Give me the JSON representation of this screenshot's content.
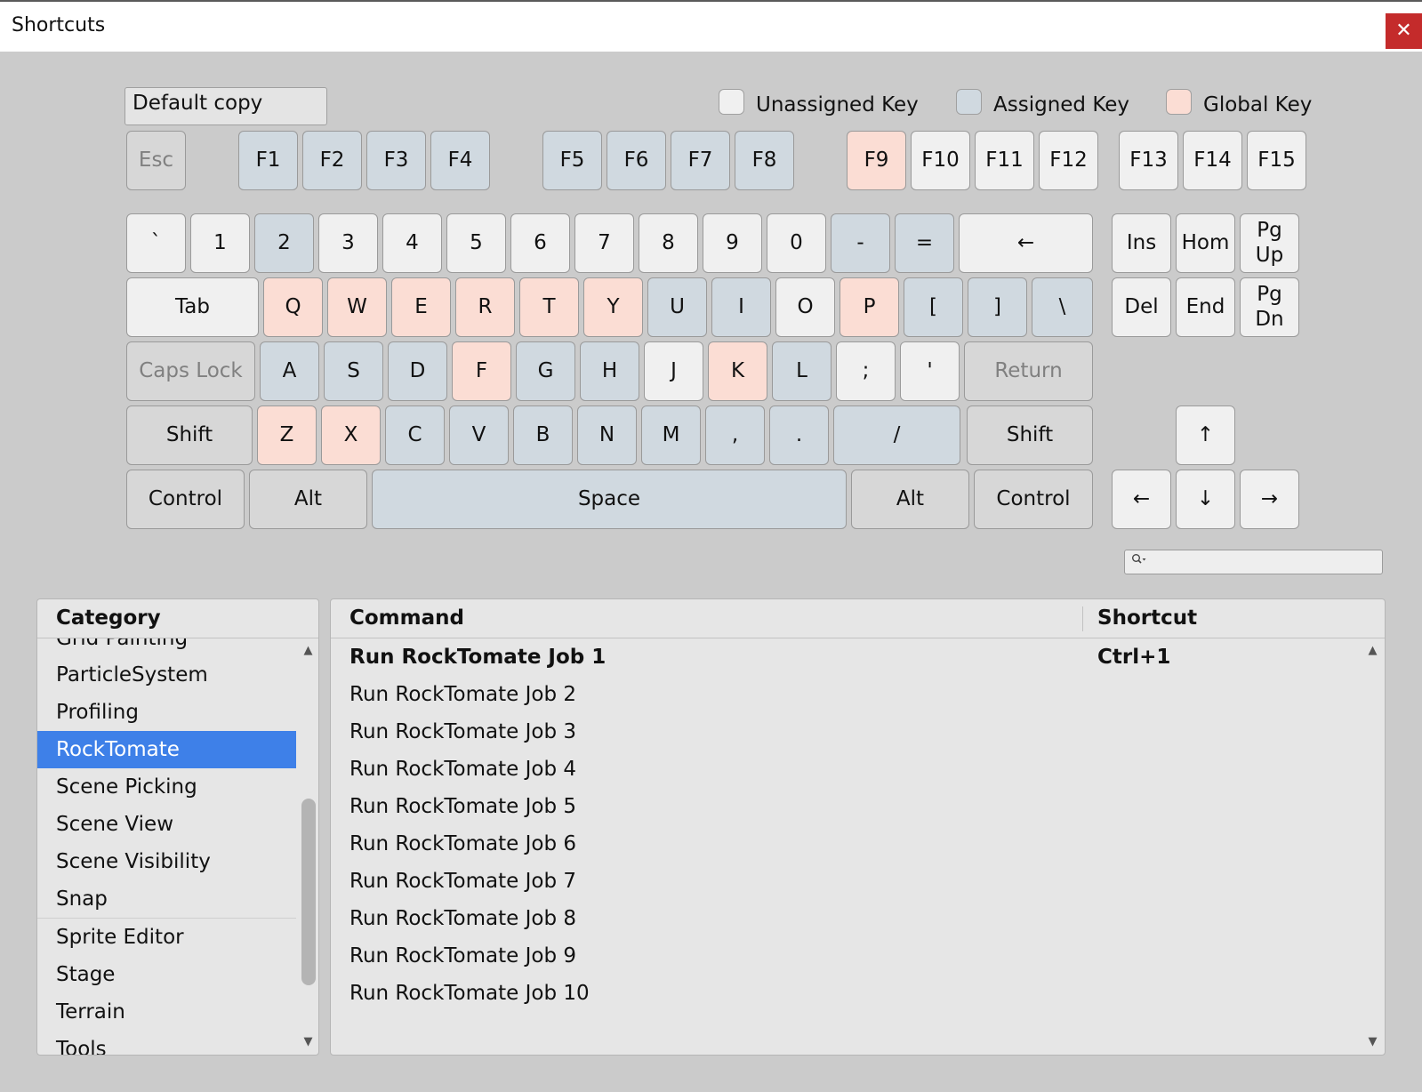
{
  "window": {
    "title": "Shortcuts",
    "close_glyph": "✕"
  },
  "profile": {
    "name": "Default copy"
  },
  "legend": {
    "unassigned": "Unassigned Key",
    "assigned": "Assigned Key",
    "global": "Global Key"
  },
  "colors": {
    "unassigned": "#f0f0f0",
    "assigned": "#d0d9e0",
    "global": "#fbddd4",
    "selection": "#3e80e8",
    "close": "#c42b2b"
  },
  "keys": {
    "esc": "Esc",
    "f1": "F1",
    "f2": "F2",
    "f3": "F3",
    "f4": "F4",
    "f5": "F5",
    "f6": "F6",
    "f7": "F7",
    "f8": "F8",
    "f9": "F9",
    "f10": "F10",
    "f11": "F11",
    "f12": "F12",
    "f13": "F13",
    "f14": "F14",
    "f15": "F15",
    "backquote": "`",
    "d1": "1",
    "d2": "2",
    "d3": "3",
    "d4": "4",
    "d5": "5",
    "d6": "6",
    "d7": "7",
    "d8": "8",
    "d9": "9",
    "d0": "0",
    "minus": "-",
    "equals": "=",
    "backspace": "←",
    "tab": "Tab",
    "q": "Q",
    "w": "W",
    "e": "E",
    "r": "R",
    "t": "T",
    "y": "Y",
    "u": "U",
    "i": "I",
    "o": "O",
    "p": "P",
    "lbracket": "[",
    "rbracket": "]",
    "backslash": "\\",
    "capslock": "Caps Lock",
    "a": "A",
    "s": "S",
    "d": "D",
    "f": "F",
    "g": "G",
    "h": "H",
    "j": "J",
    "k": "K",
    "l": "L",
    "semicolon": ";",
    "quote": "'",
    "return": "Return",
    "lshift": "Shift",
    "z": "Z",
    "x": "X",
    "c": "C",
    "v": "V",
    "b": "B",
    "n": "N",
    "m": "M",
    "comma": ",",
    "period": ".",
    "slash": "/",
    "rshift": "Shift",
    "lcontrol": "Control",
    "lalt": "Alt",
    "space": "Space",
    "ralt": "Alt",
    "rcontrol": "Control",
    "ins": "Ins",
    "home": "Hom",
    "pgup": "Pg\nUp",
    "del": "Del",
    "end": "End",
    "pgdn": "Pg\nDn",
    "up": "↑",
    "left": "←",
    "down": "↓",
    "right": "→"
  },
  "search": {
    "placeholder": "",
    "icon": "search-icon"
  },
  "category_panel": {
    "header": "Category",
    "items": [
      "Grid Painting",
      "ParticleSystem",
      "Profiling",
      "RockTomate",
      "Scene Picking",
      "Scene View",
      "Scene Visibility",
      "Snap",
      "Sprite Editor",
      "Stage",
      "Terrain",
      "Tools"
    ],
    "selected": "RockTomate"
  },
  "command_panel": {
    "headers": {
      "command": "Command",
      "shortcut": "Shortcut"
    },
    "rows": [
      {
        "command": "Run RockTomate Job 1",
        "shortcut": "Ctrl+1"
      },
      {
        "command": "Run RockTomate Job 2",
        "shortcut": ""
      },
      {
        "command": "Run RockTomate Job 3",
        "shortcut": ""
      },
      {
        "command": "Run RockTomate Job 4",
        "shortcut": ""
      },
      {
        "command": "Run RockTomate Job 5",
        "shortcut": ""
      },
      {
        "command": "Run RockTomate Job 6",
        "shortcut": ""
      },
      {
        "command": "Run RockTomate Job 7",
        "shortcut": ""
      },
      {
        "command": "Run RockTomate Job 8",
        "shortcut": ""
      },
      {
        "command": "Run RockTomate Job 9",
        "shortcut": ""
      },
      {
        "command": "Run RockTomate Job 10",
        "shortcut": ""
      }
    ]
  },
  "scroll_glyphs": {
    "up": "▲",
    "down": "▼"
  }
}
